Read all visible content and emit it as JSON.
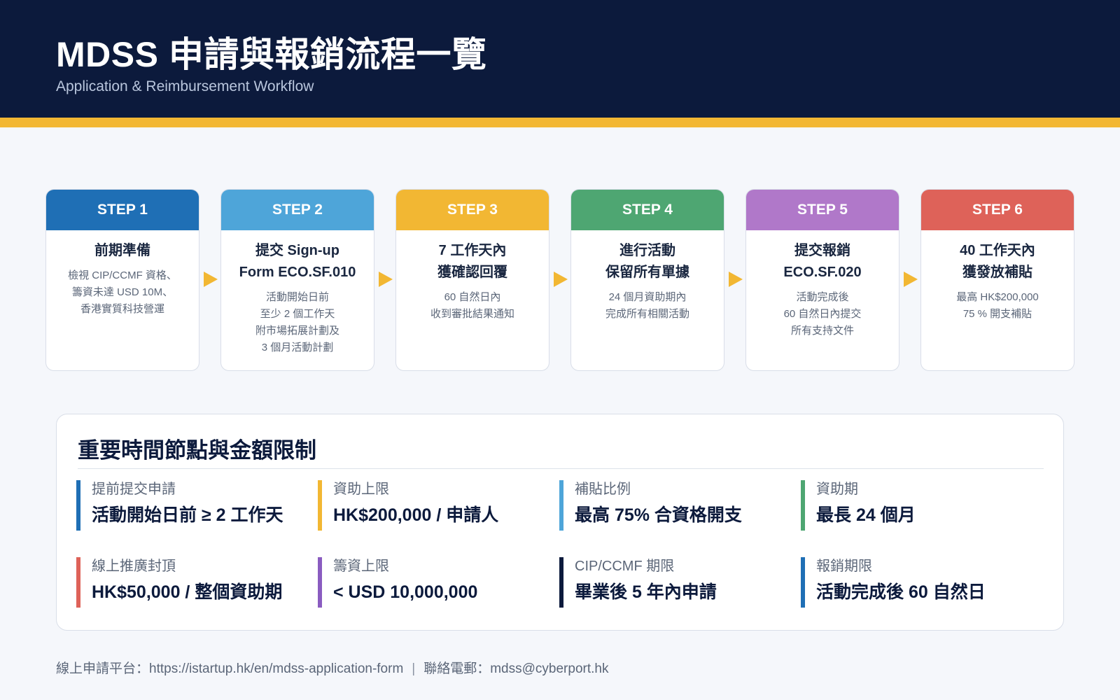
{
  "header": {
    "title": "MDSS 申請與報銷流程一覽",
    "subtitle": "Application & Reimbursement Workflow"
  },
  "colors": {
    "header_bg": "#0c1a3c",
    "accent": "#f2b733",
    "step1": "#1f6fb5",
    "step2": "#4ea5d9",
    "step3": "#f2b733",
    "step4": "#4ea672",
    "step5": "#b078c9",
    "step6": "#de6259"
  },
  "steps": [
    {
      "label": "STEP 1",
      "title": "前期準備",
      "desc": "檢視 CIP/CCMF 資格、\n籌資未達 USD 10M、\n香港實質科技營運",
      "color": "#1f6fb5"
    },
    {
      "label": "STEP 2",
      "title": "提交 Sign-up\nForm ECO.SF.010",
      "desc": "活動開始日前\n至少 2 個工作天\n附市場拓展計劃及\n3 個月活動計劃",
      "color": "#4ea5d9"
    },
    {
      "label": "STEP 3",
      "title": "7 工作天內\n獲確認回覆",
      "desc": "60 自然日內\n收到審批結果通知",
      "color": "#f2b733"
    },
    {
      "label": "STEP 4",
      "title": "進行活動\n保留所有單據",
      "desc": "24 個月資助期內\n完成所有相關活動",
      "color": "#4ea672"
    },
    {
      "label": "STEP 5",
      "title": "提交報銷\nECO.SF.020",
      "desc": "活動完成後\n60 自然日內提交\n所有支持文件",
      "color": "#b078c9"
    },
    {
      "label": "STEP 6",
      "title": "40 工作天內\n獲發放補貼",
      "desc": "最高 HK$200,000\n75 % 開支補貼",
      "color": "#de6259"
    }
  ],
  "limits": {
    "title": "重要時間節點與金額限制",
    "items": [
      {
        "label": "提前提交申請",
        "value": "活動開始日前 ≥ 2 工作天",
        "color": "#1f6fb5"
      },
      {
        "label": "資助上限",
        "value": "HK$200,000 / 申請人",
        "color": "#f2b733"
      },
      {
        "label": "補貼比例",
        "value": "最高 75% 合資格開支",
        "color": "#4ea5d9"
      },
      {
        "label": "資助期",
        "value": "最長 24 個月",
        "color": "#4ea672"
      },
      {
        "label": "線上推廣封頂",
        "value": "HK$50,000 / 整個資助期",
        "color": "#de6259"
      },
      {
        "label": "籌資上限",
        "value": "< USD 10,000,000",
        "color": "#8a5cc0"
      },
      {
        "label": "CIP/CCMF 期限",
        "value": "畢業後 5 年內申請",
        "color": "#0c1a3c"
      },
      {
        "label": "報銷期限",
        "value": "活動完成後 60 自然日",
        "color": "#1f6fb5"
      }
    ]
  },
  "footer": {
    "platform_label": "線上申請平台：",
    "platform_url": "https://istartup.hk/en/mdss-application-form",
    "separator": "|",
    "email_label": "聯絡電郵：",
    "email": "mdss@cyberport.hk"
  }
}
